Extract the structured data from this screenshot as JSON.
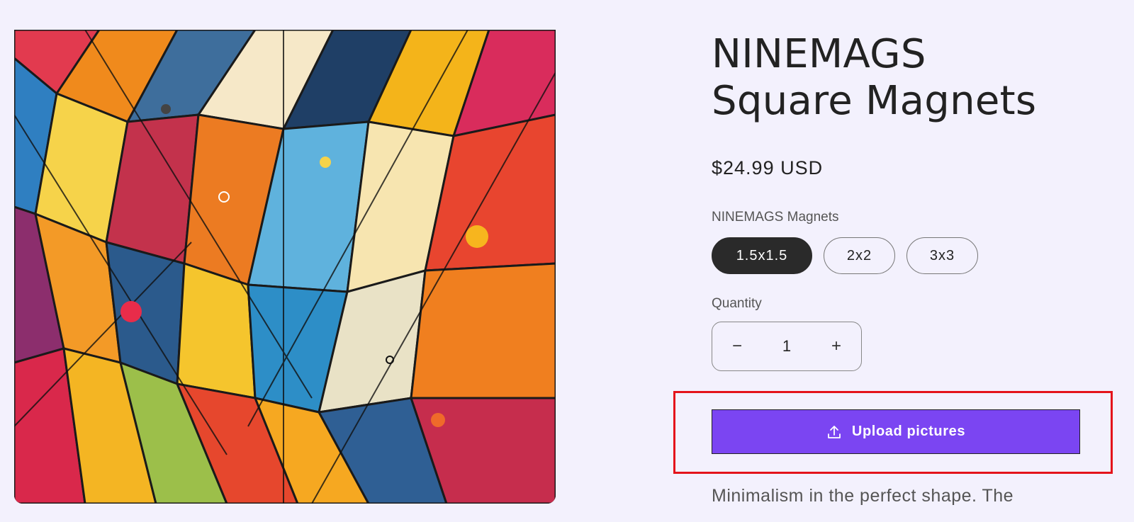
{
  "product": {
    "title_line1": "NINEMAGS",
    "title_line2": "Square Magnets",
    "price": "$24.99 USD",
    "variant_label": "NINEMAGS Magnets",
    "variants": [
      {
        "label": "1.5x1.5",
        "selected": true
      },
      {
        "label": "2x2",
        "selected": false
      },
      {
        "label": "3x3",
        "selected": false
      }
    ],
    "quantity_label": "Quantity",
    "quantity": "1",
    "decrement_symbol": "−",
    "increment_symbol": "+",
    "upload_label": "Upload pictures",
    "upload_icon": "upload-icon",
    "description": "Minimalism in the perfect shape. The"
  },
  "colors": {
    "background": "#f3f1fd",
    "accent": "#7b45f2",
    "selected_pill": "#2a2a2a",
    "highlight_box": "#e4141b"
  }
}
